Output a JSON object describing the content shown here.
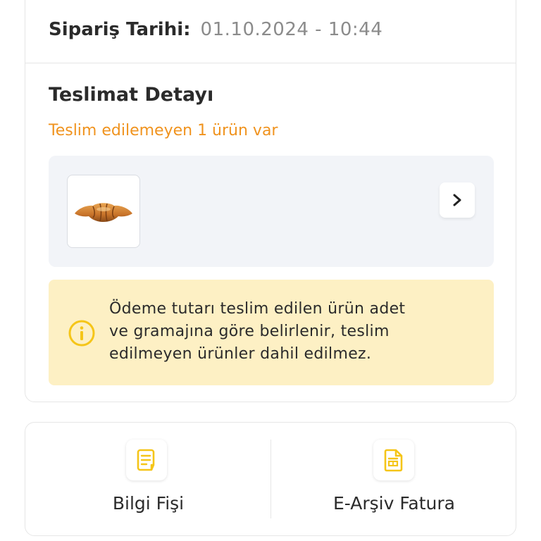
{
  "order_info": {
    "date_label": "Sipariş Tarihi:",
    "date_value": "01.10.2024 - 10:44"
  },
  "delivery": {
    "title": "Teslimat Detayı",
    "undelivered_notice": "Teslim edilemeyen 1 ürün var",
    "product_image": "croissant"
  },
  "info_notice": {
    "lines": [
      "Ödeme tutarı teslim edilen ürün adet",
      "ve gramajına göre belirlenir, teslim",
      "edilmeyen ürünler dahil edilmez."
    ],
    "icon": "info-icon"
  },
  "documents": {
    "items": [
      {
        "label": "Bilgi Fişi",
        "icon": "receipt-icon"
      },
      {
        "label": "E-Arşiv Fatura",
        "icon": "invoice-document-icon"
      }
    ]
  },
  "colors": {
    "accent": "#f0931e",
    "icon_yellow": "#f5c518",
    "info_bg": "#fdf0c4",
    "product_bg": "#f2f4f8"
  }
}
